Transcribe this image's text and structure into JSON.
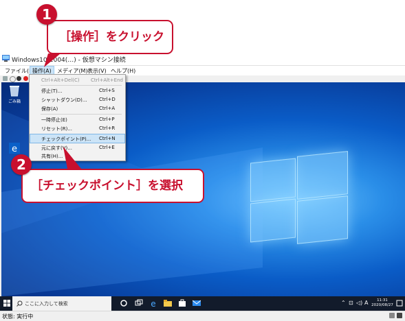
{
  "window": {
    "title": "Windows10-2004(…) - 仮想マシン接続",
    "menus": [
      "ファイル(F)",
      "操作(A)",
      "メディア(M)",
      "表示(V)",
      "ヘルプ(H)"
    ]
  },
  "action_menu": {
    "items": [
      {
        "label": "Ctrl+Alt+Del(C)",
        "shortcut": "Ctrl+Alt+End",
        "disabled": true
      },
      {
        "label": "停止(T)...",
        "shortcut": "Ctrl+S"
      },
      {
        "label": "シャットダウン(D)...",
        "shortcut": "Ctrl+D"
      },
      {
        "label": "保存(A)",
        "shortcut": "Ctrl+A"
      },
      {
        "label": "一時停止(E)",
        "shortcut": "Ctrl+P"
      },
      {
        "label": "リセット(R)...",
        "shortcut": "Ctrl+R"
      },
      {
        "label": "チェックポイント(P)...",
        "shortcut": "Ctrl+N",
        "highlighted": true
      },
      {
        "label": "元に戻す(V)...",
        "shortcut": "Ctrl+E"
      },
      {
        "label": "共有(H)...",
        "shortcut": ""
      }
    ]
  },
  "desktop": {
    "icons": [
      {
        "name": "recycle-bin",
        "label": "ごみ箱"
      },
      {
        "name": "edge",
        "label": "Microsoft Edge"
      }
    ]
  },
  "taskbar": {
    "search_placeholder": "ここに入力して検索",
    "ime": "A",
    "time": "11:31",
    "date": "2020/08/27"
  },
  "status": {
    "text": "状態: 実行中"
  },
  "annotations": [
    {
      "number": "1",
      "text": "［操作］をクリック"
    },
    {
      "number": "2",
      "text": "［チェックポイント］を選択"
    }
  ],
  "colors": {
    "accent": "#c8102e",
    "menu_highlight": "#cce4f7",
    "taskbar": "#121b2b"
  }
}
